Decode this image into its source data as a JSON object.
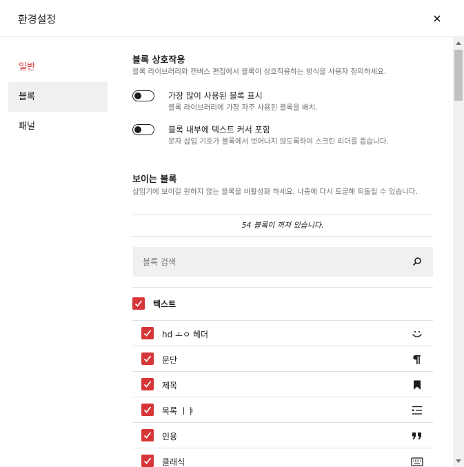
{
  "modal": {
    "title": "환경설정"
  },
  "sidebar": {
    "items": [
      {
        "label": "일반"
      },
      {
        "label": "블록"
      },
      {
        "label": "패널"
      }
    ]
  },
  "interaction": {
    "title": "블록 상호작용",
    "description": "블록 라이브러리와 캔버스 편집에서 블록이 상호작용하는 방식을 사용자 정의하세요.",
    "options": [
      {
        "label": "가장 많이 사용된 블록 표시",
        "help": "블록 라이브러리에 가장 자주 사용된 블록을 배치.",
        "enabled": false
      },
      {
        "label": "블록 내부에 텍스트 커서 포함",
        "help": "문자 삽입 기호가 블록에서 벗어나지 않도록하여 스크린 리더를 돕습니다.",
        "enabled": false
      }
    ]
  },
  "visible_blocks": {
    "title": "보이는 블록",
    "description": "삽입기에 보이길 원하지 않는 블록을 비활성화 하세요. 나중에 다시 토글해 되돌릴 수 있습니다.",
    "hidden_count_text": "54 블록이 꺼져 있습니다.",
    "search": {
      "placeholder": "블록 검색",
      "value": ""
    },
    "category": {
      "label": "텍스트",
      "checked": true
    },
    "blocks": [
      {
        "label": "hd ㅗㅇ 헤더",
        "icon": "smile-icon",
        "checked": true
      },
      {
        "label": "문단",
        "icon": "paragraph-icon",
        "checked": true
      },
      {
        "label": "제목",
        "icon": "bookmark-icon",
        "checked": true
      },
      {
        "label": "목록 ㅣㅑ",
        "icon": "list-icon",
        "checked": true
      },
      {
        "label": "인용",
        "icon": "quote-icon",
        "checked": true
      },
      {
        "label": "클래식",
        "icon": "keyboard-icon",
        "checked": true
      }
    ]
  },
  "colors": {
    "accent": "#d63638",
    "text": "#1e1e1e",
    "muted": "#757575",
    "border": "#e0e0e0",
    "search_bg": "#f0f0f0"
  }
}
